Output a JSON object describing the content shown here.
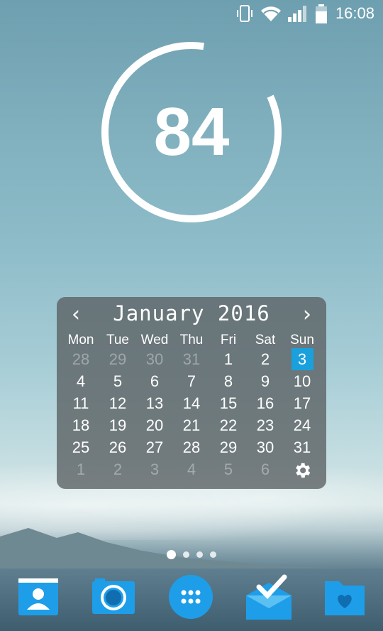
{
  "status_bar": {
    "time": "16:08",
    "icons": [
      "vibrate-icon",
      "wifi-icon",
      "signal-icon",
      "battery-icon"
    ]
  },
  "battery_widget": {
    "value": "84",
    "level_percent": 84
  },
  "calendar": {
    "title": "January 2016",
    "weekdays": [
      "Mon",
      "Tue",
      "Wed",
      "Thu",
      "Fri",
      "Sat",
      "Sun"
    ],
    "weeks": [
      [
        "28",
        "29",
        "30",
        "31",
        "1",
        "2",
        "3"
      ],
      [
        "4",
        "5",
        "6",
        "7",
        "8",
        "9",
        "10"
      ],
      [
        "11",
        "12",
        "13",
        "14",
        "15",
        "16",
        "17"
      ],
      [
        "18",
        "19",
        "20",
        "21",
        "22",
        "23",
        "24"
      ],
      [
        "25",
        "26",
        "27",
        "28",
        "29",
        "30",
        "31"
      ],
      [
        "1",
        "2",
        "3",
        "4",
        "5",
        "6",
        ""
      ]
    ],
    "today": "3",
    "accent_color": "#1aa0dc"
  },
  "home_pages": {
    "count": 4,
    "active_index": 0
  },
  "dock": {
    "apps": [
      "contacts-icon",
      "camera-icon",
      "app-drawer-icon",
      "inbox-icon",
      "file-manager-icon"
    ]
  }
}
